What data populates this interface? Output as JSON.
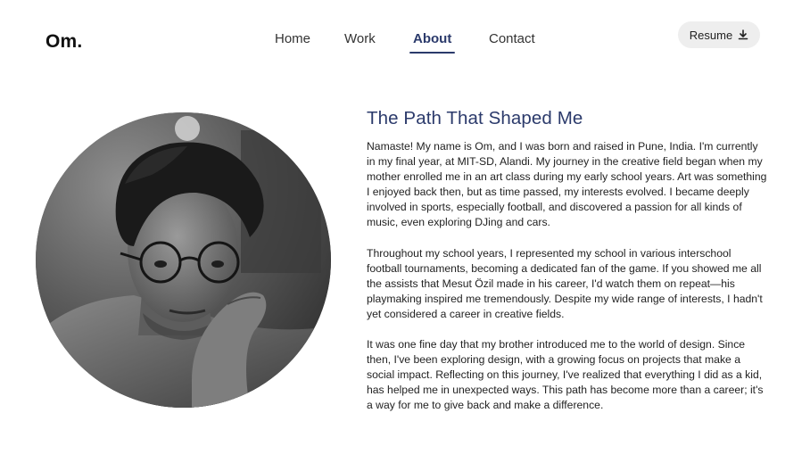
{
  "header": {
    "logo": "Om.",
    "nav": [
      {
        "label": "Home"
      },
      {
        "label": "Work"
      },
      {
        "label": "About",
        "active": true
      },
      {
        "label": "Contact"
      }
    ],
    "resume_label": "Resume",
    "resume_icon": "download-icon"
  },
  "about": {
    "heading": "The Path That Shaped Me",
    "paragraphs": [
      "Namaste! My name is Om, and I was born and raised in Pune, India. I'm currently in my final year, at MIT-SD, Alandi. My journey in the creative field began when my mother enrolled me in an art class during my early school years. Art was something I enjoyed back then, but as time passed, my interests evolved. I became deeply involved in sports, especially football, and discovered a passion for all kinds of music, even exploring DJing and cars.",
      "Throughout my school years, I represented my school in various interschool football tournaments, becoming a dedicated fan of the game. If you showed me all the assists that Mesut Özil made in his career, I'd watch them on repeat—his playmaking inspired me tremendously. Despite my wide range of interests, I hadn't yet considered a career in creative fields.",
      "It was one fine day that my brother introduced me to the world of design. Since then, I've been exploring design, with a growing focus on projects that make a social impact. Reflecting on this journey, I've realized that everything I did as a kid, has helped me in unexpected ways. This path has become more than a career; it's a way for me to give back and make a difference."
    ]
  },
  "colors": {
    "accent": "#2b3a6b",
    "button_bg": "#eeeeee",
    "text": "#222222"
  }
}
